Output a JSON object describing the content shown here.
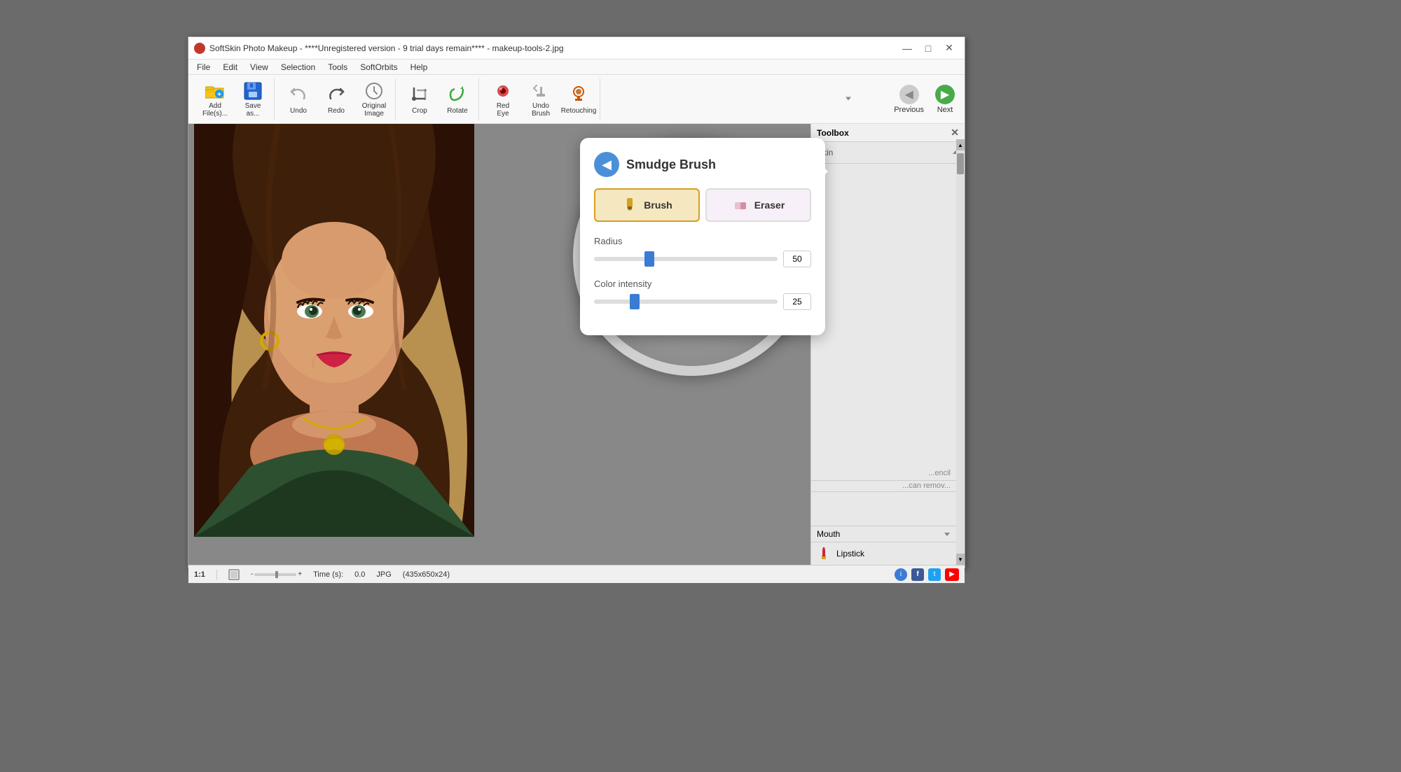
{
  "window": {
    "title": "SoftSkin Photo Makeup - ****Unregistered version - 9 trial days remain**** - makeup-tools-2.jpg",
    "icon_color": "#c0392b"
  },
  "title_buttons": {
    "minimize": "—",
    "maximize": "□",
    "close": "✕"
  },
  "menu": {
    "items": [
      "File",
      "Edit",
      "View",
      "Selection",
      "Tools",
      "SoftOrbits",
      "Help"
    ]
  },
  "toolbar": {
    "buttons": [
      {
        "id": "add-files",
        "label": "Add\nFile(s)...",
        "icon": "folder-icon"
      },
      {
        "id": "save-as",
        "label": "Save\nas...",
        "icon": "save-icon"
      },
      {
        "id": "undo",
        "label": "Undo",
        "icon": "undo-icon"
      },
      {
        "id": "redo",
        "label": "Redo",
        "icon": "redo-icon"
      },
      {
        "id": "original-image",
        "label": "Original\nImage",
        "icon": "original-icon"
      },
      {
        "id": "crop",
        "label": "Crop",
        "icon": "crop-icon"
      },
      {
        "id": "rotate",
        "label": "Rotate",
        "icon": "rotate-icon"
      },
      {
        "id": "red-eye",
        "label": "Red\nEye",
        "icon": "redeye-icon"
      },
      {
        "id": "undo-brush",
        "label": "Undo\nBrush",
        "icon": "undobrush-icon"
      },
      {
        "id": "retouching",
        "label": "Retouching",
        "icon": "retouching-icon"
      }
    ],
    "nav": {
      "previous_label": "Previous",
      "next_label": "Next"
    }
  },
  "toolbox": {
    "title": "Toolbox",
    "sections": {
      "skin": {
        "label": "Skin"
      },
      "mouth": {
        "label": "Mouth"
      }
    }
  },
  "smudge_brush": {
    "title": "Smudge Brush",
    "back_icon": "◀",
    "brush_label": "Brush",
    "eraser_label": "Eraser",
    "radius_label": "Radius",
    "radius_value": "50",
    "radius_percent": 30,
    "color_intensity_label": "Color intensity",
    "color_intensity_value": "25",
    "color_intensity_percent": 22
  },
  "status_bar": {
    "zoom": "1:1",
    "time_label": "Time (s):",
    "time_value": "0.0",
    "format": "JPG",
    "dimensions": "(435x650x24)",
    "info_icon": "ℹ",
    "share_icon": "f",
    "social_icon": "t",
    "video_icon": "▶"
  },
  "lipstick": {
    "label": "Lipstick"
  }
}
